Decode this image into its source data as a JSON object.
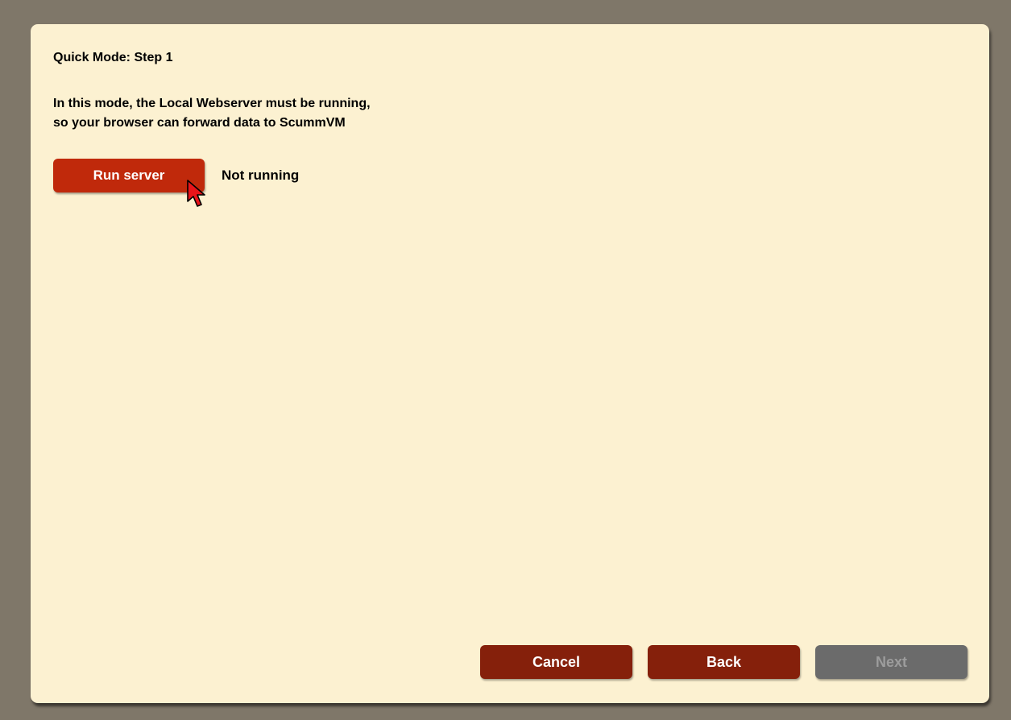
{
  "dialog": {
    "title": "Quick Mode: Step 1",
    "description_lines": [
      "In this mode, the Local Webserver must be running,",
      "so your browser can forward data to ScummVM"
    ],
    "run_button_label": "Run server",
    "server_status": "Not running"
  },
  "footer": {
    "cancel_label": "Cancel",
    "back_label": "Back",
    "next_label": "Next",
    "next_enabled": false
  },
  "colors": {
    "background": "#7f7769",
    "dialog": "#fcf1d1",
    "run_button": "#c0290b",
    "footer_button": "#85200b",
    "disabled_button": "#6b6b6b"
  },
  "icons": {
    "cursor": "mouse-pointer-icon"
  }
}
